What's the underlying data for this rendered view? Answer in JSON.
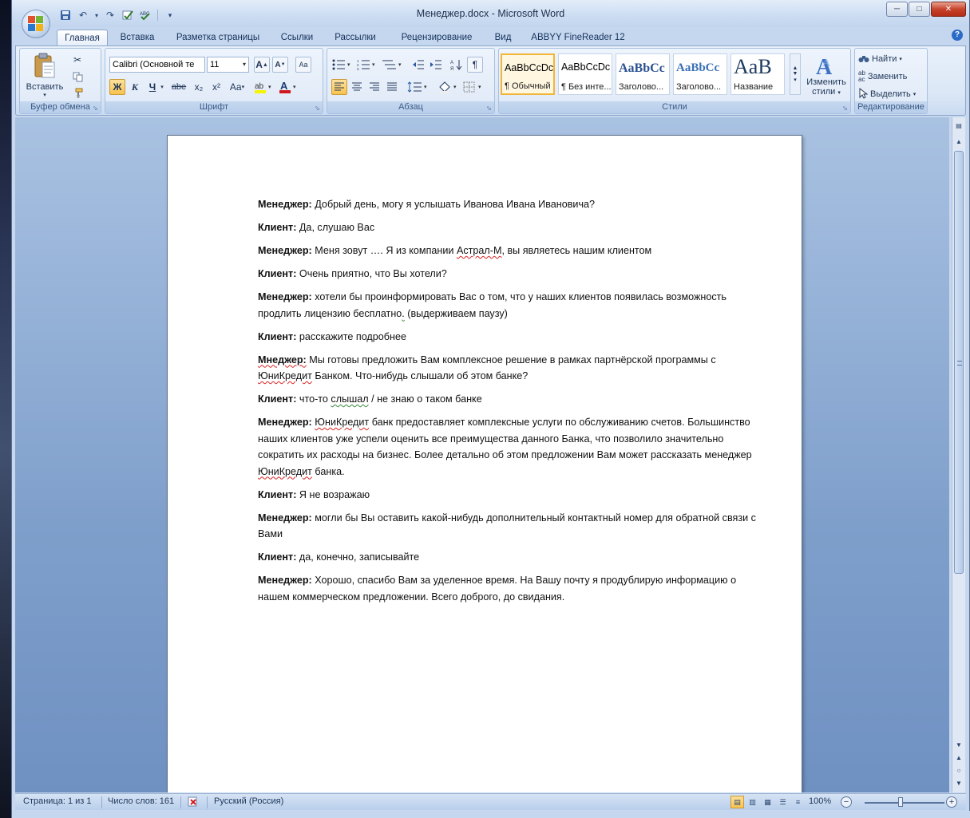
{
  "window": {
    "title": "Менеджер.docx - Microsoft Word",
    "min": "─",
    "max": "□",
    "close": "✕"
  },
  "qat": {
    "save_icon": "💾",
    "undo_icon": "↶",
    "redo_icon": "↷",
    "customize_icon": "▾"
  },
  "tabs": [
    {
      "label": "Главная"
    },
    {
      "label": "Вставка"
    },
    {
      "label": "Разметка страницы"
    },
    {
      "label": "Ссылки"
    },
    {
      "label": "Рассылки"
    },
    {
      "label": "Рецензирование"
    },
    {
      "label": "Вид"
    },
    {
      "label": "ABBYY FineReader 12"
    }
  ],
  "clipboard": {
    "paste_label": "Вставить",
    "group_label": "Буфер обмена"
  },
  "font": {
    "font_name": "Calibri (Основной те",
    "font_size": "11",
    "group_label": "Шрифт",
    "bold": "Ж",
    "italic": "К",
    "underline": "Ч",
    "strike": "abe",
    "subscript": "x₂",
    "superscript": "x²",
    "case": "Aa"
  },
  "paragraph": {
    "group_label": "Абзац"
  },
  "styles": {
    "group_label": "Стили",
    "items": [
      {
        "preview": "AaBbCcDc",
        "name": "¶ Обычный"
      },
      {
        "preview": "AaBbCcDc",
        "name": "¶ Без инте..."
      },
      {
        "preview": "AaBbCc",
        "name": "Заголово..."
      },
      {
        "preview": "AaBbCc",
        "name": "Заголово..."
      },
      {
        "preview": "AaB",
        "name": "Название"
      }
    ],
    "change_label_1": "Изменить",
    "change_label_2": "стили"
  },
  "editing": {
    "find": "Найти",
    "replace": "Заменить",
    "select": "Выделить",
    "group_label": "Редактирование"
  },
  "document": {
    "paragraphs": [
      {
        "speaker": "Менеджер:",
        "text": "  Добрый день, могу я услышать Иванова Ивана Ивановича?"
      },
      {
        "speaker": "Клиент:",
        "text": " Да, слушаю Вас"
      },
      {
        "speaker": "Менеджер:",
        "text_1": " Меня зовут …. Я из компании ",
        "err": "Астрал-М",
        "text_2": ", вы являетесь нашим клиентом"
      },
      {
        "speaker": "Клиент:",
        "text": " Очень приятно, что Вы хотели?"
      },
      {
        "speaker": "Менеджер:",
        "text_1": " хотели бы проинформировать Вас о том, что у наших клиентов появилась возможность продлить лицензию бесплатно",
        "err": ".",
        "text_2": " (выдерживаем паузу)"
      },
      {
        "speaker": "Клиент:",
        "text": " расскажите подробнее"
      },
      {
        "speaker": "Мнеджер:",
        "text_1": " Мы готовы предложить Вам комплексное решение в рамках партнёрской программы с ",
        "err": "ЮниКредит",
        "text_2": " Банком. Что-нибудь слышали об этом банке?"
      },
      {
        "speaker": "Клиент:",
        "text_1": "  что-то ",
        "err": "слышал",
        "text_2": " / не знаю о таком банке"
      },
      {
        "speaker": "Менеджер:",
        "text_0": " ",
        "err": "ЮниКредит",
        "text_1": " банк предоставляет комплексные услуги по обслуживанию счетов. Большинство наших клиентов уже успели оценить все преимущества данного Банка, что позволило значительно сократить их расходы на бизнес. Более детально об этом предложении Вам может рассказать менеджер ",
        "err2": "ЮниКредит",
        "text_2": " банка."
      },
      {
        "speaker": "Клиент:",
        "text": "  Я не возражаю"
      },
      {
        "speaker": "Менеджер:",
        "text": " могли бы Вы оставить какой-нибудь дополнительный контактный номер для обратной связи с Вами"
      },
      {
        "speaker": "Клиент:",
        "text": " да, конечно, записывайте"
      },
      {
        "speaker": "Менеджер:",
        "text": " Хорошо, спасибо Вам за уделенное время. На Вашу почту я  продублирую информацию о нашем коммерческом предложении. Всего доброго, до свидания."
      }
    ]
  },
  "status": {
    "page": "Страница: 1 из 1",
    "words": "Число слов: 161",
    "language": "Русский (Россия)",
    "zoom": "100%"
  }
}
